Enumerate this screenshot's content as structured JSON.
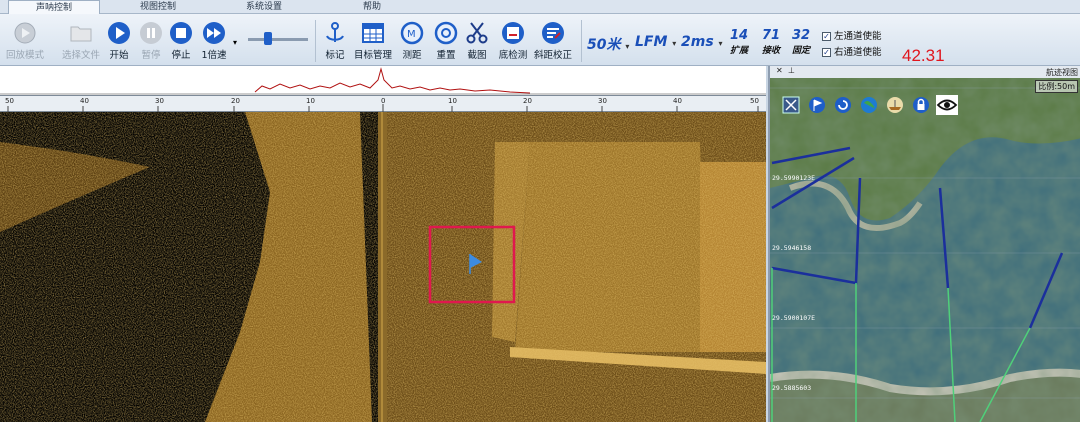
{
  "tabs": [
    {
      "label": "声呐控制",
      "active": true
    },
    {
      "label": "视图控制",
      "active": false
    },
    {
      "label": "系统设置",
      "active": false
    },
    {
      "label": "帮助",
      "active": false
    }
  ],
  "toolbar": {
    "playback_mode": "回放模式",
    "select_file": "选择文件",
    "start": "开始",
    "pause": "暂停",
    "stop": "停止",
    "speed": "1倍速",
    "mark": "标记",
    "target_mgmt": "目标管理",
    "measure": "测距",
    "reset": "重置",
    "screenshot": "截图",
    "bottom_detect": "底检测",
    "slant_correct": "斜距校正",
    "range": "50米",
    "waveform": "LFM",
    "pulse": "2ms",
    "expand": {
      "value": "14",
      "label": "扩展"
    },
    "receive": {
      "value": "71",
      "label": "接收"
    },
    "fixed": {
      "value": "32",
      "label": "固定"
    },
    "left_channel": "左通道使能",
    "right_channel": "右通道使能",
    "reading": "42.31"
  },
  "ruler": {
    "ticks": [
      "50",
      "40",
      "30",
      "20",
      "10",
      "0",
      "10",
      "20",
      "30",
      "40",
      "50"
    ]
  },
  "track_view": {
    "title": "航迹视图",
    "close": "✕",
    "pin": "⊥",
    "scale": "比例:50m",
    "lat_labels": [
      "29.5990123E",
      "29.5946158",
      "29.5900107E",
      "29.5885603"
    ]
  },
  "colors": {
    "accent": "#1a4fb8",
    "reading": "#e0161e",
    "target_box": "#e0184e",
    "sonar": "#b5852a"
  }
}
